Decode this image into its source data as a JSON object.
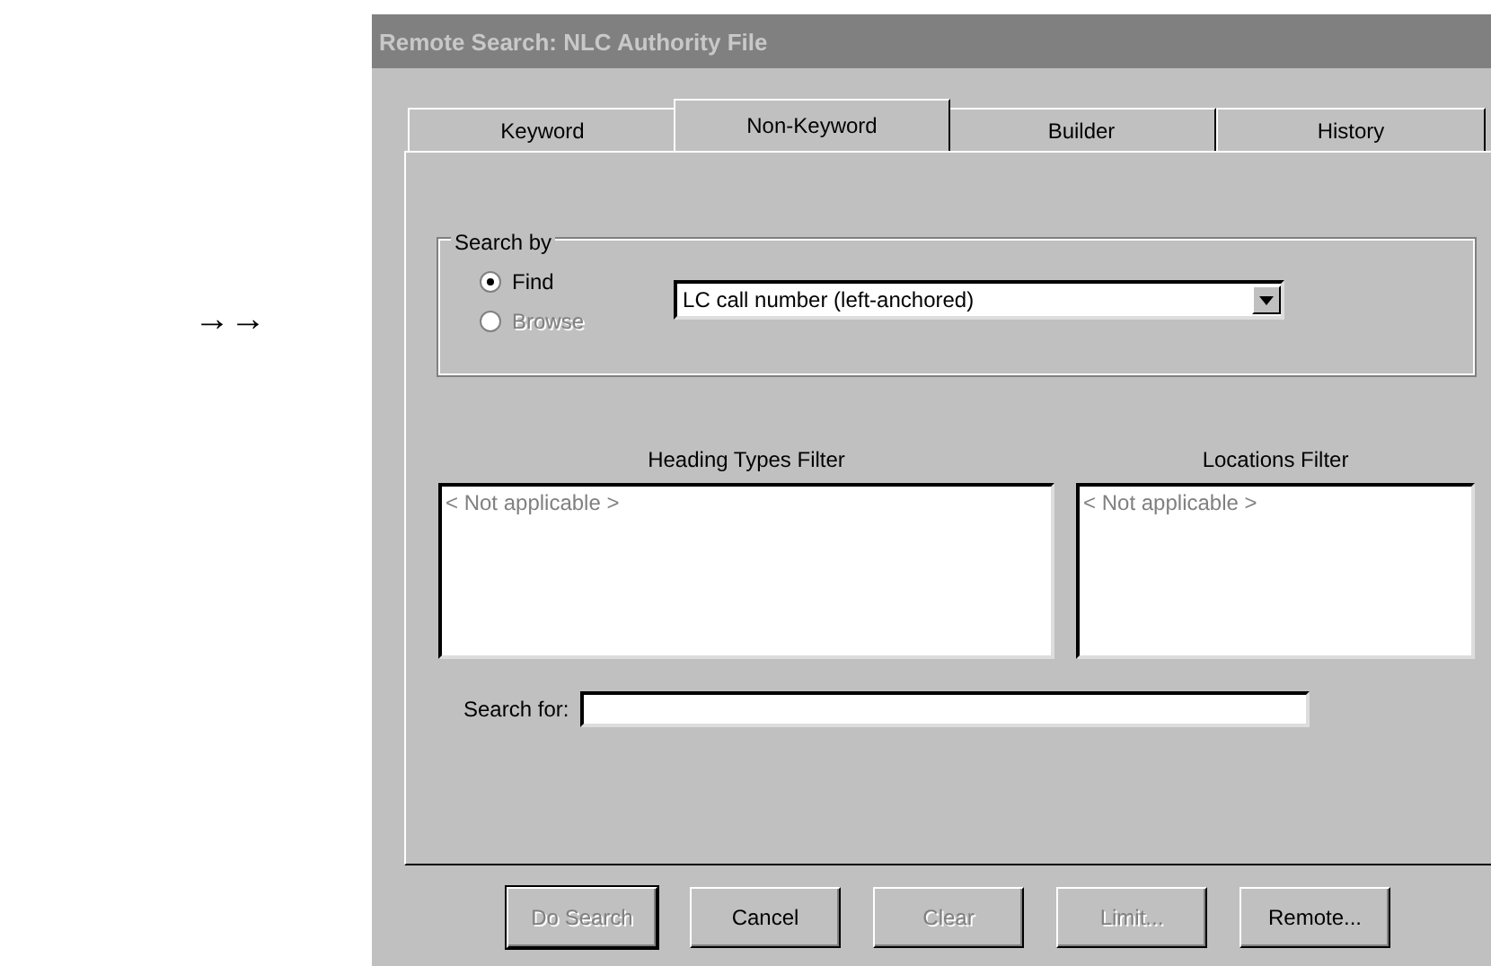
{
  "side_marker": "→→",
  "window": {
    "title": "Remote Search: NLC Authority File"
  },
  "tabs": [
    {
      "label": "Keyword",
      "selected": false
    },
    {
      "label": "Non-Keyword",
      "selected": true
    },
    {
      "label": "Builder",
      "selected": false
    },
    {
      "label": "History",
      "selected": false
    }
  ],
  "search_by": {
    "label": "Search by",
    "options": [
      {
        "label": "Find",
        "selected": true,
        "disabled": false
      },
      {
        "label": "Browse",
        "selected": false,
        "disabled": true
      }
    ],
    "dropdown": {
      "value": "LC call number (left-anchored)"
    }
  },
  "filters": [
    {
      "label": "Heading Types Filter",
      "disabled": true,
      "items": [
        "< Not applicable >"
      ]
    },
    {
      "label": "Locations Filter",
      "disabled": true,
      "items": [
        "< Not applicable >"
      ]
    }
  ],
  "search_for": {
    "label": "Search for:"
  },
  "buttons": [
    {
      "label": "Do Search",
      "disabled": true,
      "default": true
    },
    {
      "label": "Cancel",
      "disabled": false,
      "default": false
    },
    {
      "label": "Clear",
      "disabled": true,
      "default": false
    },
    {
      "label": "Limit...",
      "disabled": true,
      "default": false
    },
    {
      "label": "Remote...",
      "disabled": false,
      "default": false
    }
  ]
}
